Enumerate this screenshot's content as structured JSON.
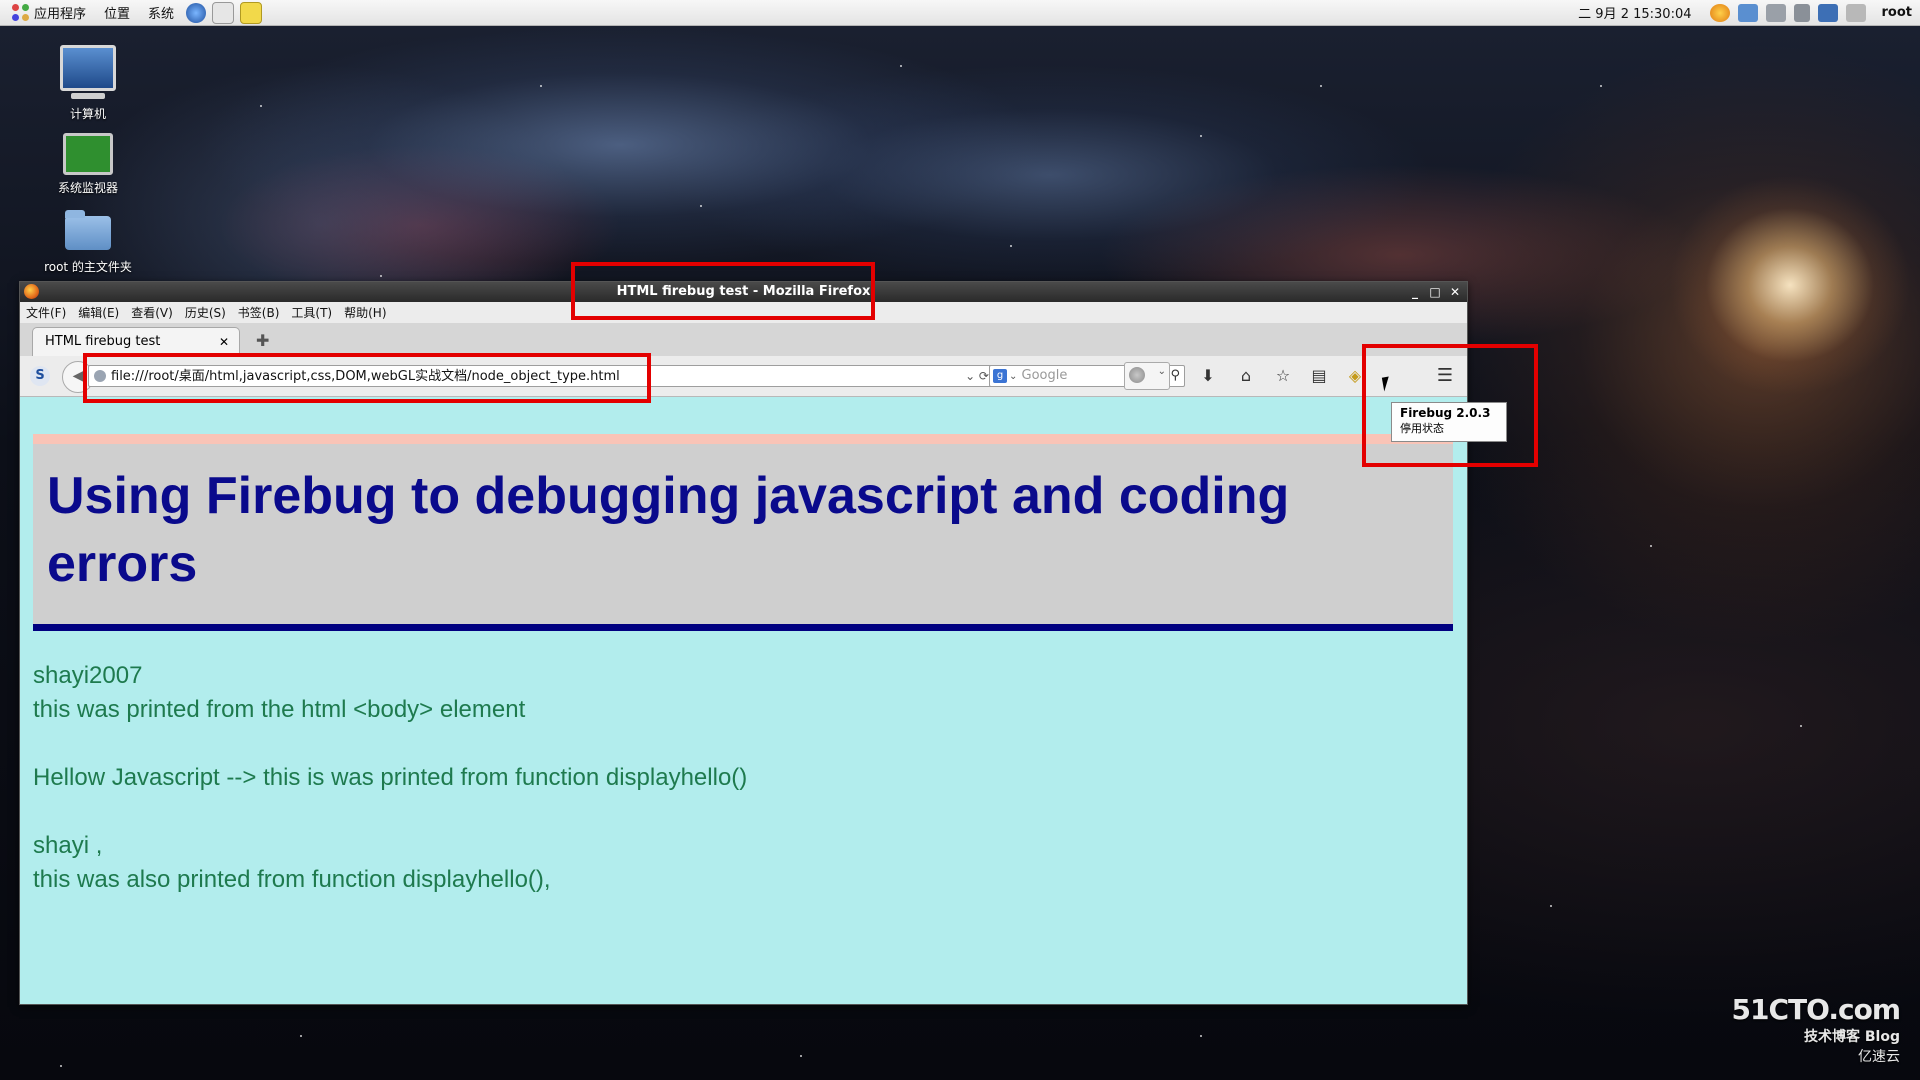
{
  "top_panel": {
    "menu_apps": "应用程序",
    "menu_places": "位置",
    "menu_system": "系统",
    "clock": "二 9月  2 15:30:04",
    "user": "root"
  },
  "desktop": {
    "icons": [
      {
        "label": "计算机"
      },
      {
        "label": "系统监视器"
      },
      {
        "label": "root 的主文件夹"
      }
    ]
  },
  "window": {
    "title": "HTML firebug test - Mozilla Firefox",
    "menus": [
      "文件(F)",
      "编辑(E)",
      "查看(V)",
      "历史(S)",
      "书签(B)",
      "工具(T)",
      "帮助(H)"
    ],
    "tab_title": "HTML firebug test",
    "url": "file:///root/桌面/html,javascript,css,DOM,webGL实战文档/node_object_type.html",
    "search_placeholder": "Google",
    "tooltip": {
      "title": "Firebug 2.0.3",
      "subtitle": "停用状态"
    }
  },
  "page": {
    "heading": "Using Firebug to debugging javascript and coding errors",
    "lines": [
      "shayi2007",
      "this was printed from the html <body> element",
      "",
      "Hellow Javascript --> this is was printed from function displayhello()",
      "",
      "shayi ,",
      "this was also printed from function displayhello(),"
    ]
  },
  "watermark": {
    "site": "51CTO.com",
    "sub": "技术博客  Blog",
    "brand": "亿速云"
  },
  "colors": {
    "page_bg": "#b2eded",
    "heading_text": "#0a0a8c",
    "body_text": "#1e7a4e",
    "annotation": "#e30000"
  }
}
